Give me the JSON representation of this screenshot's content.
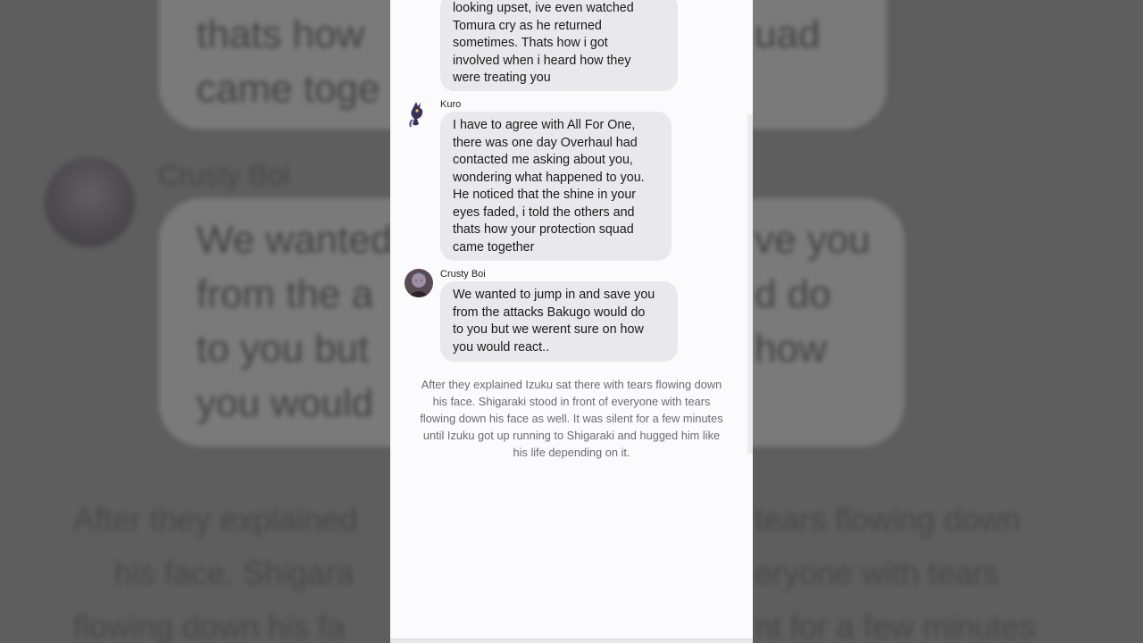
{
  "background": {
    "name": "Crusty Boi",
    "bubble_lines_top": [
      "thats how",
      "came toge"
    ],
    "bubble_lines_top_right": [
      "uad"
    ],
    "bubble_lines_mid": [
      "We wanted",
      "from the a",
      "to you but",
      "you would"
    ],
    "bubble_lines_mid_right": [
      "ve you",
      "d do",
      "how"
    ],
    "narration_lines": [
      "After they explained",
      "his face. Shigara",
      "flowing down his fa"
    ],
    "narration_lines_right": [
      "tears flowing down",
      "eryone with tears",
      "nt for a few minutes"
    ]
  },
  "chat": {
    "messages": [
      {
        "sender": "",
        "avatar": "",
        "lines": [
          "looking upset, ive even watched",
          "Tomura cry as he returned",
          "sometimes. Thats how i got",
          "involved when i heard how they",
          "were treating you"
        ]
      },
      {
        "sender": "Kuro",
        "avatar": "kuro-avatar-icon",
        "lines": [
          "I have to agree with All For One,",
          "there was one day Overhaul had",
          "contacted me asking about you,",
          "wondering what happened to you.",
          "He noticed that the shine in your",
          "eyes faded, i told the others and",
          "thats how your protection squad",
          "came together"
        ]
      },
      {
        "sender": "Crusty Boi",
        "avatar": "crusty-boi-avatar-icon",
        "lines": [
          "We wanted to jump in and save you",
          "from the attacks Bakugo would do",
          "to you but we werent sure on how",
          "you would react.."
        ]
      }
    ],
    "narration_lines": [
      "After they explained Izuku sat there with tears flowing down",
      "his face. Shigaraki stood in front of everyone with tears",
      "flowing down his face as well. It was silent for a few minutes",
      "until Izuku got up running to Shigaraki and hugged him like",
      "his life depending on it."
    ]
  },
  "colors": {
    "bubble": "#e9e8ec",
    "screen": "#fbfafd",
    "narration_text": "#6b6b70"
  }
}
